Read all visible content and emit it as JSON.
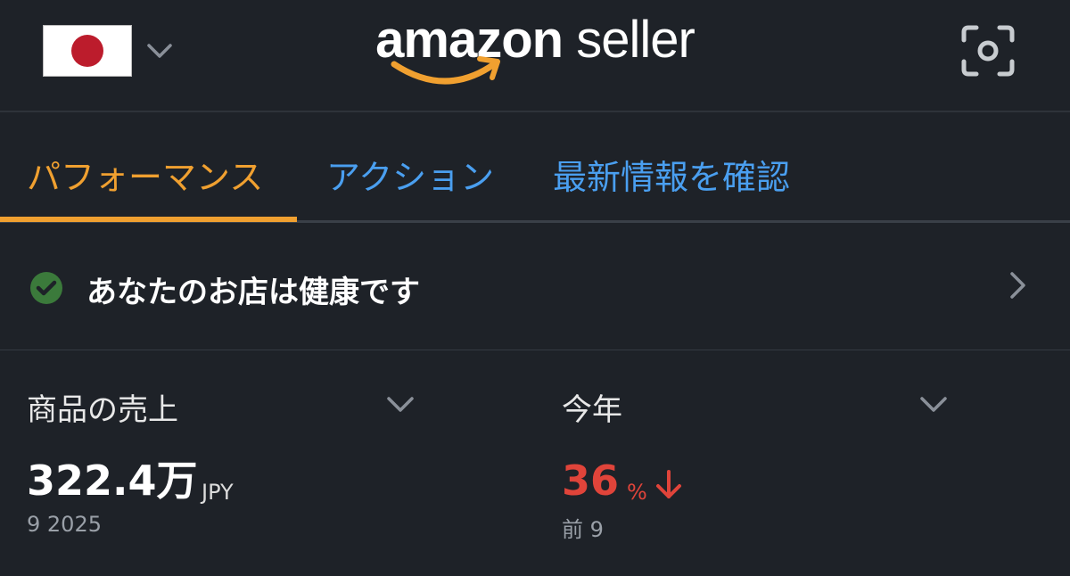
{
  "header": {
    "country_flag": "japan-flag",
    "logo_bold": "amazon",
    "logo_light": " seller",
    "icons": {
      "dropdown": "chevron-down-icon",
      "scan": "scan-camera-icon"
    }
  },
  "tabs": [
    {
      "label": "パフォーマンス",
      "active": true
    },
    {
      "label": "アクション",
      "active": false
    },
    {
      "label": "最新情報を確認",
      "active": false
    }
  ],
  "health": {
    "status_text": "あなたのお店は健康です",
    "status_color": "#4caf50"
  },
  "metrics": {
    "left": {
      "label": "商品の売上",
      "value": "322.4万",
      "unit": "JPY",
      "period": "9 2025"
    },
    "right": {
      "label": "今年",
      "value": "36",
      "unit": "%",
      "trend": "down",
      "comparison": "前 9"
    }
  },
  "colors": {
    "background": "#1e2228",
    "active_tab": "#f0a030",
    "link_tab": "#4a9ff0",
    "negative": "#e0443a"
  }
}
